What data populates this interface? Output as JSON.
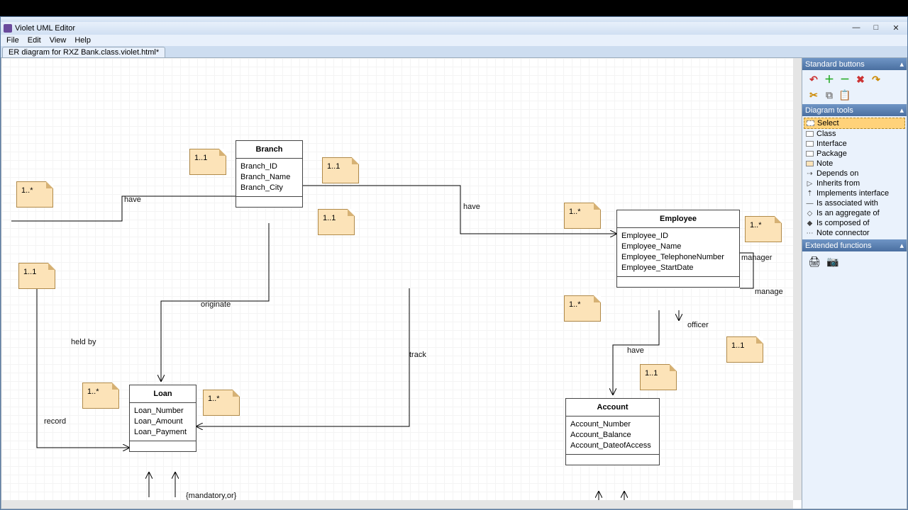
{
  "window": {
    "title": "Violet UML Editor",
    "minimize": "—",
    "maximize": "□",
    "close": "✕"
  },
  "menubar": {
    "file": "File",
    "edit": "Edit",
    "view": "View",
    "help": "Help"
  },
  "tab": {
    "name": "ER diagram for RXZ Bank.class.violet.html*"
  },
  "panels": {
    "standard": {
      "title": "Standard buttons",
      "buttons": [
        "undo",
        "add",
        "remove",
        "delete",
        "redo",
        "rotate",
        "copy",
        "paste"
      ]
    },
    "tools": {
      "title": "Diagram tools",
      "items": [
        {
          "label": "Select",
          "selected": true,
          "swatch": "dashed"
        },
        {
          "label": "Class",
          "swatch": "white"
        },
        {
          "label": "Interface",
          "swatch": "white"
        },
        {
          "label": "Package",
          "swatch": "white"
        },
        {
          "label": "Note",
          "swatch": "note"
        },
        {
          "label": "Depends on",
          "icon": "⇢"
        },
        {
          "label": "Inherits from",
          "icon": "▷"
        },
        {
          "label": "Implements interface",
          "icon": "⇡"
        },
        {
          "label": "Is associated with",
          "icon": "—"
        },
        {
          "label": "Is an aggregate of",
          "icon": "◇"
        },
        {
          "label": "Is composed of",
          "icon": "◆"
        },
        {
          "label": "Note connector",
          "icon": "⋯"
        }
      ]
    },
    "extended": {
      "title": "Extended functions",
      "buttons": [
        "print",
        "snapshot"
      ]
    }
  },
  "classes": {
    "branch": {
      "name": "Branch",
      "attrs": [
        "Branch_ID",
        "Branch_Name",
        "Branch_City"
      ]
    },
    "employee": {
      "name": "Employee",
      "attrs": [
        "Employee_ID",
        "Employee_Name",
        "Employee_TelephoneNumber",
        "Employee_StartDate"
      ]
    },
    "loan": {
      "name": "Loan",
      "attrs": [
        "Loan_Number",
        "Loan_Amount",
        "Loan_Payment"
      ]
    },
    "account": {
      "name": "Account",
      "attrs": [
        "Account_Number",
        "Account_Balance",
        "Account_DateofAccess"
      ]
    }
  },
  "notes": {
    "n1": "1..1",
    "n2": "1..1",
    "n3": "1..1",
    "n4": "1..*",
    "n5": "1..1",
    "n6": "1..*",
    "n7": "1..*",
    "n8": "1..*",
    "n9": "1..*",
    "n10": "1..*",
    "n11": "1..1",
    "n12": "1..1"
  },
  "labels": {
    "have1": "have",
    "have2": "have",
    "have3": "have",
    "originate": "originate",
    "heldby": "held by",
    "track": "track",
    "record": "record",
    "officer": "officer",
    "manager": "manager",
    "manage": "manage",
    "mandatory": "{mandatory,or}"
  }
}
